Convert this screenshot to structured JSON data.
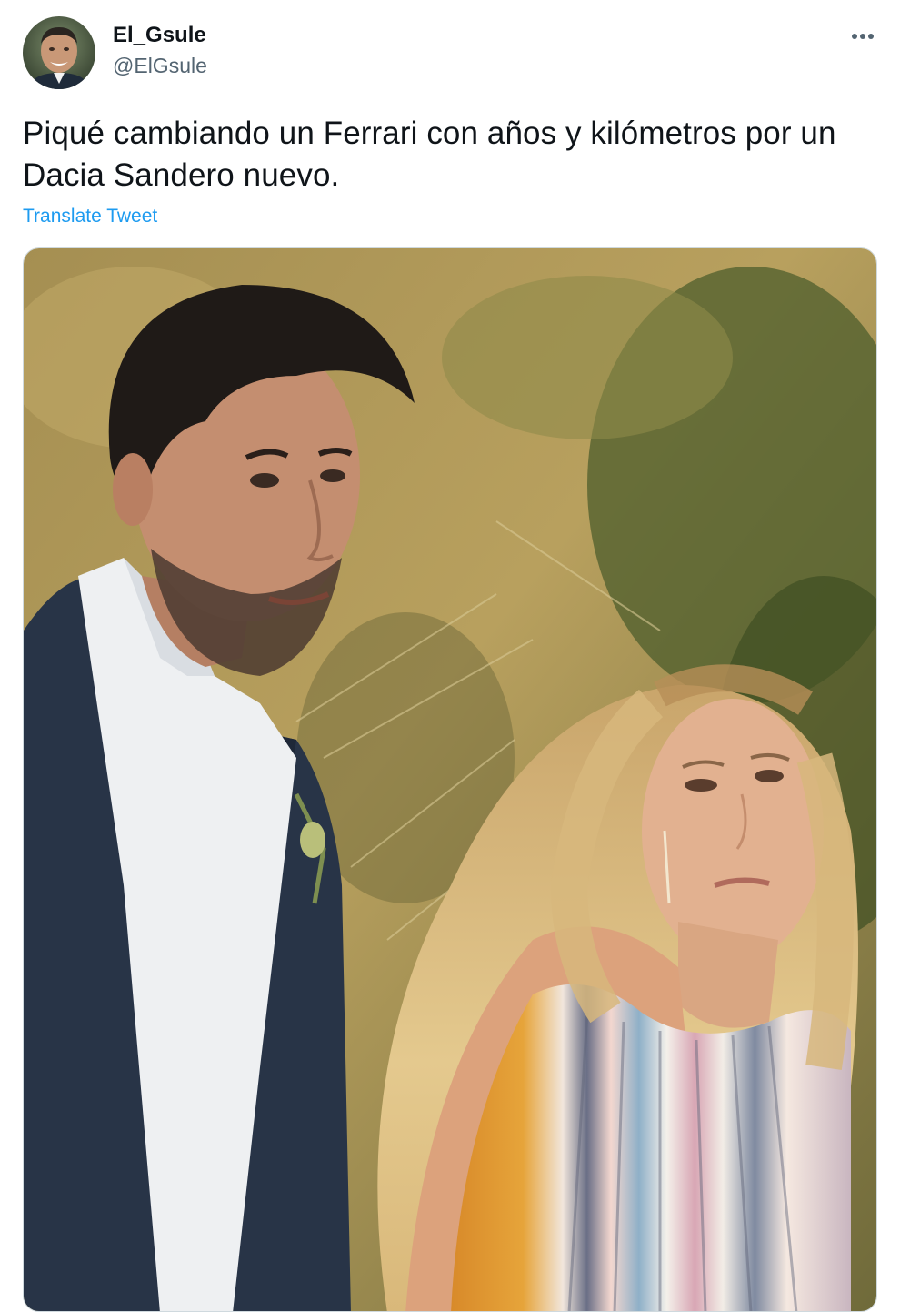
{
  "tweet": {
    "author": {
      "display_name": "El_Gsule",
      "handle": "@ElGsule"
    },
    "text": "Piqué cambiando un Ferrari con años y kilómetros por un Dacia Sandero nuevo.",
    "translate_label": "Translate Tweet",
    "more_icon": "more-horizontal-icon"
  },
  "colors": {
    "text_primary": "#0f1419",
    "text_secondary": "#536471",
    "link": "#1d9bf0",
    "border": "#cfd9de"
  }
}
